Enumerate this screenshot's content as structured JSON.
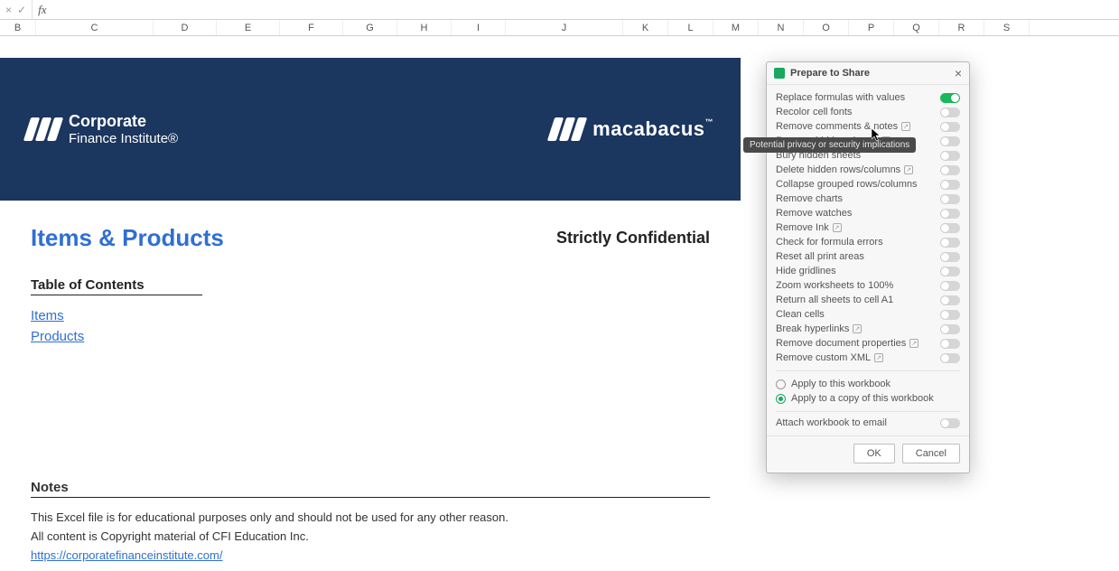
{
  "formula_bar": {
    "fx_label": "fx",
    "value": ""
  },
  "columns": [
    "B",
    "C",
    "D",
    "E",
    "F",
    "G",
    "H",
    "I",
    "J",
    "K",
    "L",
    "M",
    "N",
    "O",
    "P",
    "Q",
    "R",
    "S"
  ],
  "doc": {
    "brand_left_line1": "Corporate",
    "brand_left_line2": "Finance Institute®",
    "brand_right": "macabacus",
    "title": "Items & Products",
    "confidential": "Strictly Confidential",
    "toc_heading": "Table of Contents",
    "toc_items": [
      "Items",
      "Products"
    ],
    "notes_heading": "Notes",
    "notes_p1": "This Excel file is for educational purposes only and should not be used for any other reason.",
    "notes_p2": "All content is Copyright material of CFI Education Inc.",
    "notes_link": "https://corporatefinanceinstitute.com/"
  },
  "dialog": {
    "title": "Prepare to Share",
    "options": [
      {
        "label": "Replace formulas with values",
        "info": false,
        "on": true
      },
      {
        "label": "Recolor cell fonts",
        "info": false,
        "on": false
      },
      {
        "label": "Remove comments & notes",
        "info": true,
        "on": false
      },
      {
        "label": "Remove hidden sheets",
        "info": true,
        "on": false
      },
      {
        "label": "Bury hidden sheets",
        "info": false,
        "on": false
      },
      {
        "label": "Delete hidden rows/columns",
        "info": true,
        "on": false
      },
      {
        "label": "Collapse grouped rows/columns",
        "info": false,
        "on": false
      },
      {
        "label": "Remove charts",
        "info": false,
        "on": false
      },
      {
        "label": "Remove watches",
        "info": false,
        "on": false
      },
      {
        "label": "Remove Ink",
        "info": true,
        "on": false
      },
      {
        "label": "Check for formula errors",
        "info": false,
        "on": false
      },
      {
        "label": "Reset all print areas",
        "info": false,
        "on": false
      },
      {
        "label": "Hide gridlines",
        "info": false,
        "on": false
      },
      {
        "label": "Zoom worksheets to 100%",
        "info": false,
        "on": false
      },
      {
        "label": "Return all sheets to cell A1",
        "info": false,
        "on": false
      },
      {
        "label": "Clean cells",
        "info": false,
        "on": false
      },
      {
        "label": "Break hyperlinks",
        "info": true,
        "on": false
      },
      {
        "label": "Remove document properties",
        "info": true,
        "on": false
      },
      {
        "label": "Remove custom XML",
        "info": true,
        "on": false
      }
    ],
    "radios": [
      {
        "label": "Apply to this workbook",
        "selected": false
      },
      {
        "label": "Apply to a copy of this workbook",
        "selected": true
      }
    ],
    "attach_label": "Attach workbook to email",
    "ok": "OK",
    "cancel": "Cancel"
  },
  "tooltip": "Potential privacy or security implications"
}
